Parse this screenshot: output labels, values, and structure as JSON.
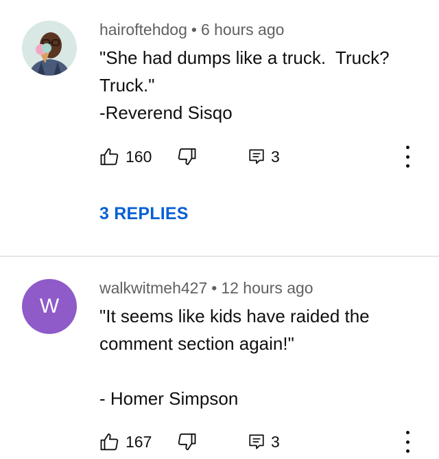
{
  "comments": [
    {
      "author": "hairoftehdog",
      "separator": "•",
      "time": "6 hours ago",
      "text": "\"She had dumps like a truck.  Truck? Truck.\"\n-Reverend Sisqo",
      "likes": "160",
      "replies_count": "3",
      "replies_label": "3 REPLIES",
      "avatar_icon": "profile-photo"
    },
    {
      "author": "walkwitmeh427",
      "separator": "•",
      "time": "12 hours ago",
      "text": "\"It seems like kids have raided the comment section again!\"\n\n- Homer Simpson",
      "likes": "167",
      "replies_count": "3",
      "avatar_letter": "W",
      "avatar_color": "#8e5bc9"
    }
  ],
  "icons": {
    "like": "thumbs-up-icon",
    "dislike": "thumbs-down-icon",
    "reply": "comment-icon",
    "more": "more-vertical-icon"
  }
}
